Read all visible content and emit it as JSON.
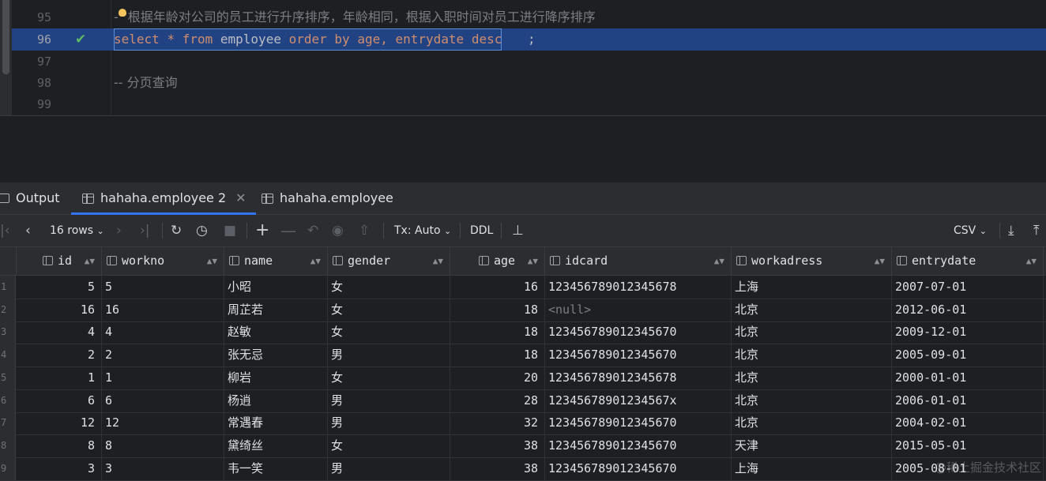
{
  "editor": {
    "lines": [
      {
        "num": "95",
        "text": "-- 根据年龄对公司的员工进行升序排序，年龄相同，根据入职时间对员工进行降序排序"
      },
      {
        "num": "96",
        "code": [
          "select",
          "*",
          "from",
          "employee",
          "order",
          "by",
          "age,",
          "entrydate",
          "desc",
          ";"
        ]
      },
      {
        "num": "97",
        "text": ""
      },
      {
        "num": "98",
        "text": "-- 分页查询"
      },
      {
        "num": "99",
        "text": ""
      }
    ],
    "line95_prefix": "-",
    "line95_rest": "根据年龄对公司的员工进行升序排序，年龄相同，根据入职时间对员工进行降序排序"
  },
  "tabs": [
    {
      "label": "Output"
    },
    {
      "label": "hahaha.employee 2",
      "active": true
    },
    {
      "label": "hahaha.employee"
    }
  ],
  "toolbar": {
    "rows_label": "16 rows",
    "tx_label": "Tx: Auto",
    "ddl_label": "DDL",
    "export_label": "CSV"
  },
  "grid": {
    "columns": [
      "id",
      "workno",
      "name",
      "gender",
      "age",
      "idcard",
      "workadress",
      "entrydate"
    ],
    "rows": [
      {
        "n": "1",
        "id": "5",
        "workno": "5",
        "name": "小昭",
        "gender": "女",
        "age": "16",
        "idcard": "123456789012345678",
        "workadress": "上海",
        "entrydate": "2007-07-01"
      },
      {
        "n": "2",
        "id": "16",
        "workno": "16",
        "name": "周芷若",
        "gender": "女",
        "age": "18",
        "idcard": "<null>",
        "workadress": "北京",
        "entrydate": "2012-06-01"
      },
      {
        "n": "3",
        "id": "4",
        "workno": "4",
        "name": "赵敏",
        "gender": "女",
        "age": "18",
        "idcard": "123456789012345670",
        "workadress": "北京",
        "entrydate": "2009-12-01"
      },
      {
        "n": "4",
        "id": "2",
        "workno": "2",
        "name": "张无忌",
        "gender": "男",
        "age": "18",
        "idcard": "123456789012345670",
        "workadress": "北京",
        "entrydate": "2005-09-01"
      },
      {
        "n": "5",
        "id": "1",
        "workno": "1",
        "name": "柳岩",
        "gender": "女",
        "age": "20",
        "idcard": "123456789012345678",
        "workadress": "北京",
        "entrydate": "2000-01-01"
      },
      {
        "n": "6",
        "id": "6",
        "workno": "6",
        "name": "杨逍",
        "gender": "男",
        "age": "28",
        "idcard": "12345678901234567x",
        "workadress": "北京",
        "entrydate": "2006-01-01"
      },
      {
        "n": "7",
        "id": "12",
        "workno": "12",
        "name": "常遇春",
        "gender": "男",
        "age": "32",
        "idcard": "123456789012345670",
        "workadress": "北京",
        "entrydate": "2004-02-01"
      },
      {
        "n": "8",
        "id": "8",
        "workno": "8",
        "name": "黛绮丝",
        "gender": "女",
        "age": "38",
        "idcard": "123456789012345670",
        "workadress": "天津",
        "entrydate": "2015-05-01"
      },
      {
        "n": "9",
        "id": "3",
        "workno": "3",
        "name": "韦一笑",
        "gender": "男",
        "age": "38",
        "idcard": "123456789012345670",
        "workadress": "上海",
        "entrydate": "2005-08-01"
      }
    ]
  },
  "watermark": "@稀土掘金技术社区"
}
